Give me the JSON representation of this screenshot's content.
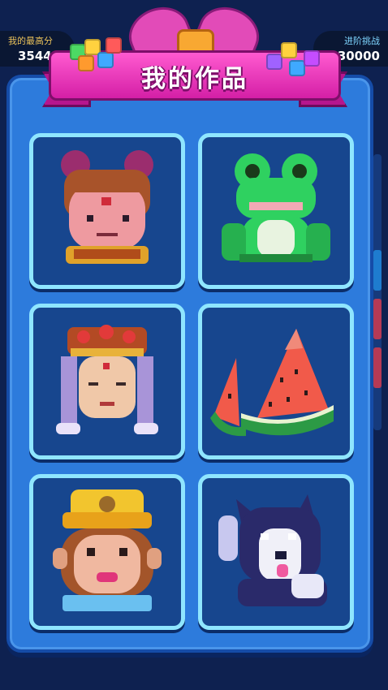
{
  "left_score": {
    "label": "我的最高分",
    "value": "3544"
  },
  "right_score": {
    "label": "进阶挑战",
    "value": "30000"
  },
  "title": "我的作品",
  "colors": {
    "panel": "#2d7bdc",
    "card_border": "#8fe6ff",
    "ribbon": "#e24bb8"
  },
  "artworks": [
    {
      "subject": "girl-with-buns"
    },
    {
      "subject": "frog"
    },
    {
      "subject": "bodhisattva"
    },
    {
      "subject": "watermelon"
    },
    {
      "subject": "monkey-king"
    },
    {
      "subject": "husky"
    }
  ]
}
